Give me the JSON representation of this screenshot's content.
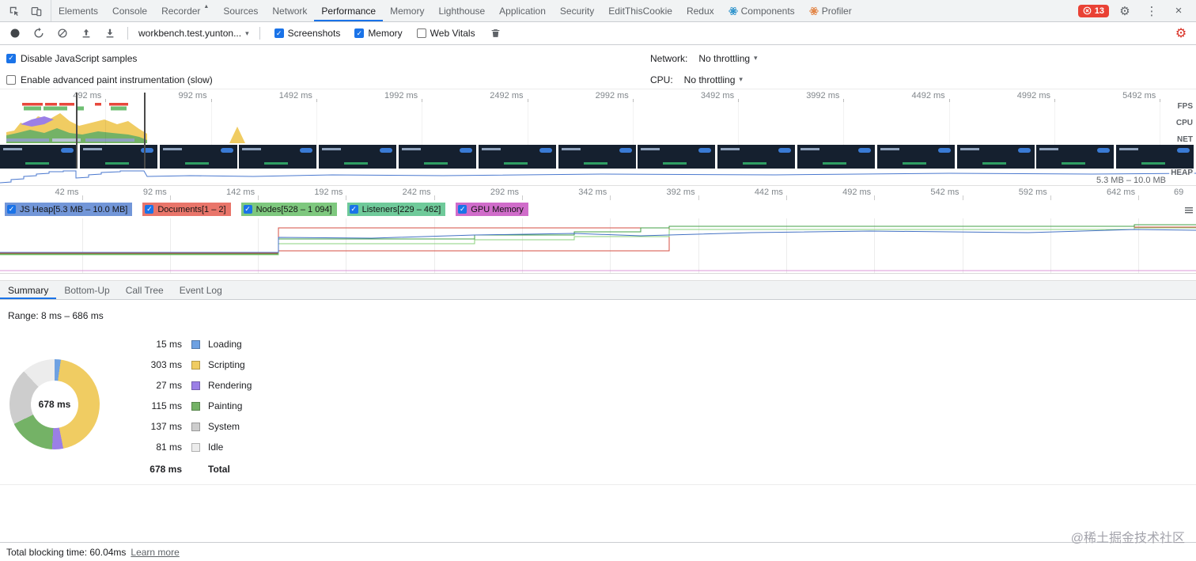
{
  "icons": {
    "settings_gear": "⚙",
    "more_options": "⋮",
    "close": "×",
    "dropdown_caret": "▾",
    "overflow_menu": "≡"
  },
  "tab_bar": {
    "tabs": [
      {
        "label": "Elements"
      },
      {
        "label": "Console"
      },
      {
        "label": "Recorder",
        "badge": "▲"
      },
      {
        "label": "Sources"
      },
      {
        "label": "Network"
      },
      {
        "label": "Performance",
        "selected": true
      },
      {
        "label": "Memory"
      },
      {
        "label": "Lighthouse"
      },
      {
        "label": "Application"
      },
      {
        "label": "Security"
      },
      {
        "label": "EditThisCookie"
      },
      {
        "label": "Redux"
      },
      {
        "label": "Components",
        "icon": "react",
        "icon_color": "#1788c7"
      },
      {
        "label": "Profiler",
        "icon": "react",
        "icon_color": "#e0762e"
      }
    ],
    "error_count": "13"
  },
  "toolbar": {
    "target_select": "workbench.test.yunton...",
    "options": [
      {
        "label": "Screenshots",
        "checked": true
      },
      {
        "label": "Memory",
        "checked": true
      },
      {
        "label": "Web Vitals",
        "checked": false
      }
    ]
  },
  "capture_settings": {
    "rows": [
      {
        "label": "Disable JavaScript samples",
        "checked": true
      },
      {
        "label": "Enable advanced paint instrumentation (slow)",
        "checked": false
      }
    ],
    "network_label": "Network:",
    "network_value": "No throttling",
    "cpu_label": "CPU:",
    "cpu_value": "No throttling"
  },
  "overview": {
    "ruler_labels": [
      "492 ms",
      "992 ms",
      "1492 ms",
      "1992 ms",
      "2492 ms",
      "2992 ms",
      "3492 ms",
      "3992 ms",
      "4492 ms",
      "4992 ms",
      "5492 ms"
    ],
    "lane_labels": [
      "FPS",
      "CPU",
      "NET"
    ],
    "heap_label": "HEAP",
    "heap_range": "5.3 MB – 10.0 MB"
  },
  "detail_ruler": [
    "42 ms",
    "92 ms",
    "142 ms",
    "192 ms",
    "242 ms",
    "292 ms",
    "342 ms",
    "392 ms",
    "442 ms",
    "492 ms",
    "542 ms",
    "592 ms",
    "642 ms",
    "69"
  ],
  "counters": [
    {
      "label": "JS Heap[5.3 MB – 10.0 MB]",
      "color": "#7296d8",
      "checked": true
    },
    {
      "label": "Documents[1 – 2]",
      "color": "#e9756a",
      "checked": true
    },
    {
      "label": "Nodes[528 – 1 094]",
      "color": "#7ec87e",
      "checked": true
    },
    {
      "label": "Listeners[229 – 462]",
      "color": "#6fca9a",
      "checked": true
    },
    {
      "label": "GPU Memory",
      "color": "#d06cca",
      "checked": true
    }
  ],
  "detail_tabs": [
    {
      "label": "Summary",
      "selected": true
    },
    {
      "label": "Bottom-Up"
    },
    {
      "label": "Call Tree"
    },
    {
      "label": "Event Log"
    }
  ],
  "summary": {
    "range": "Range: 8 ms – 686 ms",
    "donut_center": "678 ms"
  },
  "chart_data": {
    "type": "pie",
    "title": "Performance summary breakdown",
    "unit": "ms",
    "categories": [
      "Loading",
      "Scripting",
      "Rendering",
      "Painting",
      "System",
      "Idle"
    ],
    "values": [
      15,
      303,
      27,
      115,
      137,
      81
    ],
    "colors": [
      "#6ea1e2",
      "#f0cc62",
      "#9b7fe6",
      "#74b266",
      "#cdcdcd",
      "#ececec"
    ],
    "total": 678,
    "total_label": "Total",
    "legend_position": "right"
  },
  "status_bar": {
    "text": "Total blocking time: 60.04ms",
    "link": "Learn more"
  },
  "watermark": "@稀土掘金技术社区"
}
